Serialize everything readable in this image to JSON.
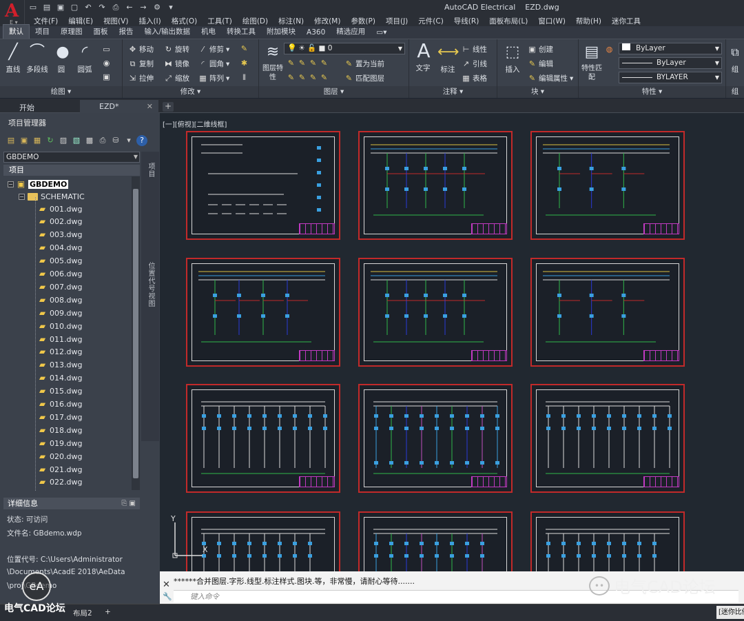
{
  "window": {
    "app_title": "AutoCAD Electrical",
    "doc_title": "EZD.dwg"
  },
  "menubar": [
    "文件(F)",
    "编辑(E)",
    "视图(V)",
    "插入(I)",
    "格式(O)",
    "工具(T)",
    "绘图(D)",
    "标注(N)",
    "修改(M)",
    "参数(P)",
    "项目(J)",
    "元件(C)",
    "导线(R)",
    "面板布局(L)",
    "窗口(W)",
    "帮助(H)",
    "迷你工具"
  ],
  "ribbon_tabs": [
    "默认",
    "项目",
    "原理图",
    "面板",
    "报告",
    "输入/输出数据",
    "机电",
    "转换工具",
    "附加模块",
    "A360",
    "精选应用"
  ],
  "ribbon": {
    "draw": {
      "title": "绘图",
      "line": "直线",
      "polyline": "多段线",
      "circle": "圆",
      "arc": "圆弧"
    },
    "modify": {
      "title": "修改",
      "move": "移动",
      "rotate": "旋转",
      "trim": "修剪",
      "copy": "复制",
      "mirror": "镜像",
      "fillet": "圆角",
      "stretch": "拉伸",
      "scale": "缩放",
      "array": "阵列"
    },
    "layers": {
      "title": "图层",
      "layer_props": "图层特性",
      "current_layer": "0",
      "set_current": "置为当前",
      "match_layer": "匹配图层"
    },
    "annotation": {
      "title": "注释",
      "text": "文字",
      "dimension": "标注",
      "linear": "线性",
      "leader": "引线",
      "table": "表格"
    },
    "block": {
      "title": "块",
      "insert": "插入",
      "create": "创建",
      "edit": "编辑",
      "edit_attr": "编辑属性"
    },
    "properties": {
      "title": "特性",
      "match": "特性匹配",
      "color": "ByLayer",
      "linetype": "ByLayer",
      "lineweight": "BYLAYER"
    },
    "group": {
      "title": "组",
      "label": "组"
    }
  },
  "doc_tabs": [
    "开始",
    "EZD*"
  ],
  "project_manager": {
    "title": "项目管理器",
    "selected_project": "GBDEMO",
    "section_projects": "项目",
    "root": "GBDEMO",
    "folder": "SCHEMATIC",
    "files": [
      "001.dwg",
      "002.dwg",
      "003.dwg",
      "004.dwg",
      "005.dwg",
      "006.dwg",
      "007.dwg",
      "008.dwg",
      "009.dwg",
      "010.dwg",
      "011.dwg",
      "012.dwg",
      "013.dwg",
      "014.dwg",
      "015.dwg",
      "016.dwg",
      "017.dwg",
      "018.dwg",
      "019.dwg",
      "020.dwg",
      "021.dwg",
      "022.dwg"
    ],
    "side_labels": [
      "项目",
      "位置代号视图"
    ],
    "details_title": "详细信息",
    "details": {
      "status": "状态: 可访问",
      "file": "文件名: GBdemo.wdp",
      "location": "位置代号: C:\\Users\\Administrator",
      "path2": "\\Documents\\AcadE 2018\\AeData",
      "path3": "\\proj\\GBdemo"
    }
  },
  "viewport": {
    "label": "[一][俯视][二维线框]"
  },
  "command": {
    "history": "******合并图层.字形.线型.标注样式.图块.等，非常慢，请耐心等待.......",
    "placeholder": "键入命令"
  },
  "layout_tabs": [
    "布局2"
  ],
  "status": {
    "mini_tool": "[迷你比例]"
  },
  "watermark": {
    "text": "电气CAD论坛",
    "text2": "电气CAD论坛"
  },
  "colors": {
    "sheet_border": "#c22a2a",
    "wire_cyan": "#3aa0e0",
    "wire_green": "#2fb84a",
    "wire_blue": "#2a3ad8",
    "wire_yellow": "#d8c040",
    "accent": "#d11f2b"
  }
}
